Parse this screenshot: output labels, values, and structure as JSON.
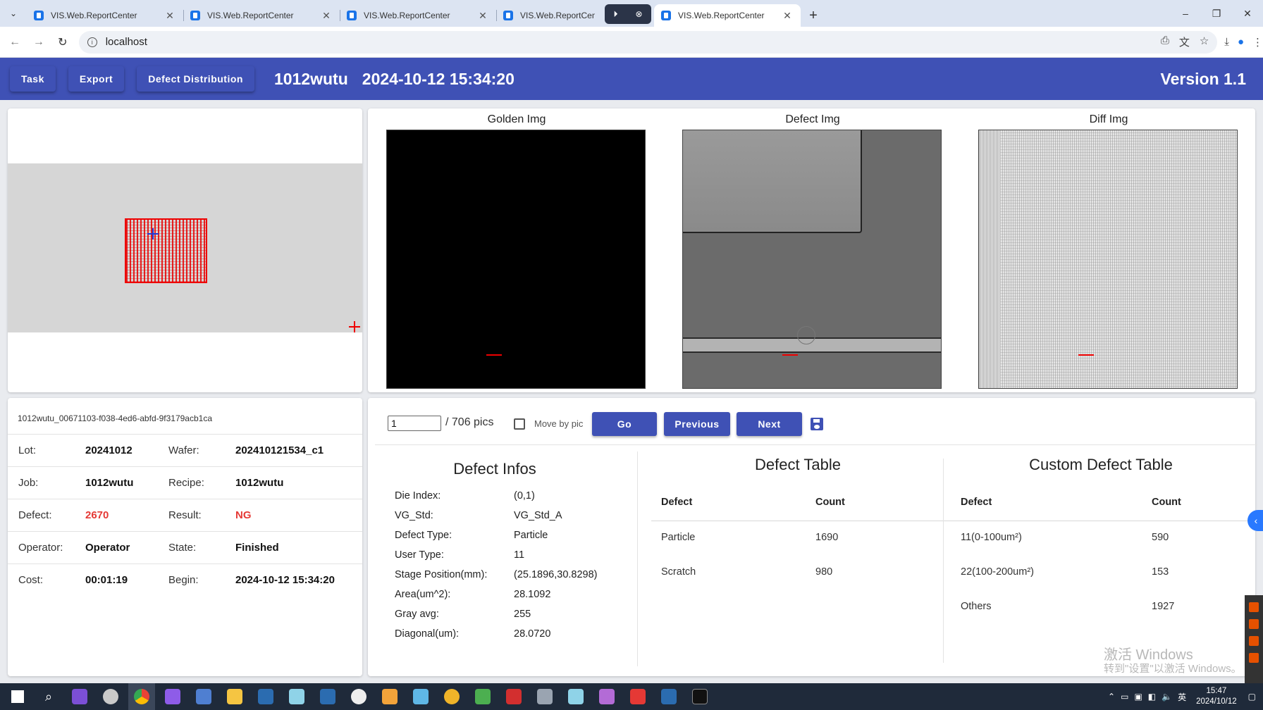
{
  "browser": {
    "tabs": [
      {
        "title": "VIS.Web.ReportCenter",
        "active": false
      },
      {
        "title": "VIS.Web.ReportCenter",
        "active": false
      },
      {
        "title": "VIS.Web.ReportCenter",
        "active": false
      },
      {
        "title": "VIS.Web.ReportCenter",
        "active": false
      },
      {
        "title": "VIS.Web.ReportCenter",
        "active": true
      }
    ],
    "url": "localhost"
  },
  "header": {
    "buttons": [
      "Task",
      "Export",
      "Defect Distribution"
    ],
    "job": "1012wutu",
    "datetime": "2024-10-12 15:34:20",
    "version": "Version 1.1"
  },
  "images": {
    "golden_label": "Golden Img",
    "defect_label": "Defect Img",
    "diff_label": "Diff Img"
  },
  "wafer_info": {
    "id": "1012wutu_00671103-f038-4ed6-abfd-9f3179acb1ca",
    "rows": [
      {
        "l1": "Lot:",
        "v1": "20241012",
        "l2": "Wafer:",
        "v2": "202410121534_c1"
      },
      {
        "l1": "Job:",
        "v1": "1012wutu",
        "l2": "Recipe:",
        "v2": "1012wutu"
      },
      {
        "l1": "Defect:",
        "v1": "2670",
        "l2": "Result:",
        "v2": "NG"
      },
      {
        "l1": "Operator:",
        "v1": "Operator",
        "l2": "State:",
        "v2": "Finished"
      },
      {
        "l1": "Cost:",
        "v1": "00:01:19",
        "l2": "Begin:",
        "v2": "2024-10-12 15:34:20"
      }
    ]
  },
  "pager": {
    "current": "1",
    "total_text": "/ 706 pics",
    "move_by_pic_label": "Move by pic",
    "move_by_pic_checked": false,
    "go_label": "Go",
    "previous_label": "Previous",
    "next_label": "Next"
  },
  "defect_infos": {
    "title": "Defect Infos",
    "items": [
      {
        "k": "Die Index:",
        "v": "(0,1)"
      },
      {
        "k": "VG_Std:",
        "v": "VG_Std_A"
      },
      {
        "k": "Defect Type:",
        "v": "Particle"
      },
      {
        "k": "User Type:",
        "v": "11"
      },
      {
        "k": "Stage Position(mm):",
        "v": "(25.1896,30.8298)"
      },
      {
        "k": "Area(um^2):",
        "v": "28.1092"
      },
      {
        "k": "Gray avg:",
        "v": "255"
      },
      {
        "k": "Diagonal(um):",
        "v": "28.0720"
      }
    ]
  },
  "defect_table": {
    "title": "Defect Table",
    "headers": [
      "Defect",
      "Count"
    ],
    "rows": [
      [
        "Particle",
        "1690"
      ],
      [
        "Scratch",
        "980"
      ]
    ]
  },
  "custom_defect_table": {
    "title": "Custom Defect Table",
    "headers": [
      "Defect",
      "Count"
    ],
    "rows": [
      [
        "11(0-100um²)",
        "590"
      ],
      [
        "22(100-200um²)",
        "153"
      ],
      [
        "Others",
        "1927"
      ]
    ]
  },
  "watermark": {
    "line1": "激活 Windows",
    "line2": "转到\"设置\"以激活 Windows。"
  },
  "taskbar": {
    "time": "15:47",
    "date": "2024/10/12",
    "ime": "英"
  },
  "colors": {
    "primary": "#3f51b5",
    "danger": "#e53935",
    "defect_red": "#e00000"
  }
}
